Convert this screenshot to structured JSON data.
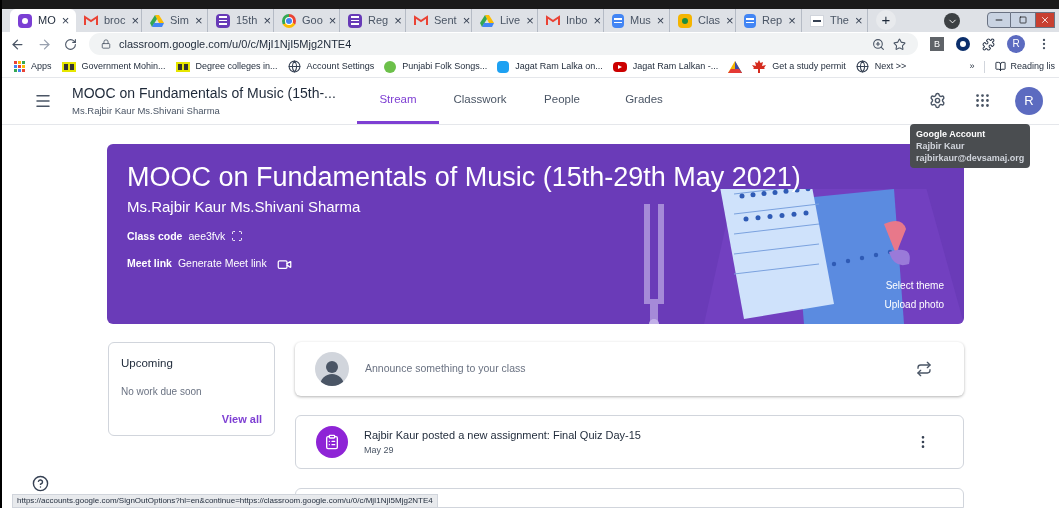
{
  "browser": {
    "tabs": [
      {
        "title": "MO",
        "kind": "classroom",
        "selected": true
      },
      {
        "title": "broc",
        "kind": "gmail",
        "selected": false
      },
      {
        "title": "Sim",
        "kind": "drive",
        "selected": false
      },
      {
        "title": "15th",
        "kind": "forms",
        "selected": false
      },
      {
        "title": "Goo",
        "kind": "chrome",
        "selected": false
      },
      {
        "title": "Reg",
        "kind": "forms",
        "selected": false
      },
      {
        "title": "Sent",
        "kind": "gmail",
        "selected": false
      },
      {
        "title": "Live",
        "kind": "drive",
        "selected": false
      },
      {
        "title": "Inbo",
        "kind": "gmail",
        "selected": false
      },
      {
        "title": "Mus",
        "kind": "docs",
        "selected": false
      },
      {
        "title": "Clas",
        "kind": "classroom-yellow",
        "selected": false
      },
      {
        "title": "Rep",
        "kind": "docs",
        "selected": false
      },
      {
        "title": "The",
        "kind": "th",
        "selected": false
      }
    ],
    "tab_close": "×",
    "new_tab": "+",
    "url": "classroom.google.com/u/0/c/MjI1NjI5Mjg2NTE4",
    "profile_initial": "R",
    "extension_label": "B",
    "bookmarks": [
      {
        "label": "Apps",
        "kind": "apps"
      },
      {
        "label": "Government Mohin...",
        "kind": "bb"
      },
      {
        "label": "Degree colleges in...",
        "kind": "bb"
      },
      {
        "label": "Account Settings",
        "kind": "globe"
      },
      {
        "label": "Punjabi Folk Songs...",
        "kind": "leaf"
      },
      {
        "label": "Jagat Ram Lalka on...",
        "kind": "blue"
      },
      {
        "label": "Jagat Ram Lalkan -...",
        "kind": "youtube"
      },
      {
        "kind": "triangle"
      },
      {
        "label": "Get a study permit",
        "kind": "maple"
      },
      {
        "label": "Next >>",
        "kind": "globe"
      }
    ],
    "bookmarks_more": "»",
    "reading_list": "Reading lis",
    "status_url": "https://accounts.google.com/SignOutOptions?hl=en&continue=https://classroom.google.com/u/0/c/MjI1NjI5Mjg2NTE4"
  },
  "header": {
    "class_title": "MOOC on Fundamentals of Music (15th-...",
    "teachers": "Ms.Rajbir Kaur Ms.Shivani Sharma",
    "tabs": [
      {
        "label": "Stream",
        "selected": true
      },
      {
        "label": "Classwork",
        "selected": false
      },
      {
        "label": "People",
        "selected": false
      },
      {
        "label": "Grades",
        "selected": false
      }
    ],
    "avatar_initial": "R"
  },
  "tooltip": {
    "title": "Google Account",
    "name": "Rajbir Kaur",
    "email": "rajbirkaur@devsamaj.org"
  },
  "banner": {
    "title": "MOOC on Fundamentals of Music (15th-29th May 2021)",
    "teachers": "Ms.Rajbir Kaur Ms.Shivani Sharma",
    "class_code_label": "Class code",
    "class_code": "aee3fvk",
    "meet_label": "Meet link",
    "meet_action": "Generate Meet link",
    "select_theme": "Select theme",
    "upload_photo": "Upload photo"
  },
  "upcoming": {
    "title": "Upcoming",
    "empty": "No work due soon",
    "view_all": "View all"
  },
  "announce": {
    "placeholder": "Announce something to your class"
  },
  "posts": [
    {
      "text": "Rajbir Kaur posted a new assignment: Final Quiz Day-15",
      "date": "May 29"
    }
  ]
}
